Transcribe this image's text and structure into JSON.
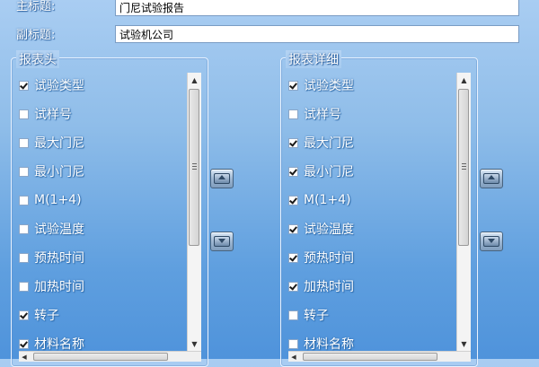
{
  "header": {
    "main_title_label": "主标题:",
    "main_title_value": "门尼试验报告",
    "sub_title_label": "副标题:",
    "sub_title_value": "试验机公司"
  },
  "left_group": {
    "title": "报表头",
    "items": [
      {
        "label": "试验类型",
        "checked": true
      },
      {
        "label": "试样号",
        "checked": false
      },
      {
        "label": "最大门尼",
        "checked": false
      },
      {
        "label": "最小门尼",
        "checked": false
      },
      {
        "label": "M(1+4)",
        "checked": false
      },
      {
        "label": "试验温度",
        "checked": false
      },
      {
        "label": "预热时间",
        "checked": false
      },
      {
        "label": "加热时间",
        "checked": false
      },
      {
        "label": "转子",
        "checked": true
      },
      {
        "label": "材料名称",
        "checked": true
      }
    ],
    "move_up_icon": "move-up-icon",
    "move_down_icon": "move-down-icon"
  },
  "right_group": {
    "title": "报表详细",
    "items": [
      {
        "label": "试验类型",
        "checked": true
      },
      {
        "label": "试样号",
        "checked": false
      },
      {
        "label": "最大门尼",
        "checked": true
      },
      {
        "label": "最小门尼",
        "checked": true
      },
      {
        "label": "M(1+4)",
        "checked": true
      },
      {
        "label": "试验温度",
        "checked": true
      },
      {
        "label": "预热时间",
        "checked": true
      },
      {
        "label": "加热时间",
        "checked": true
      },
      {
        "label": "转子",
        "checked": false
      },
      {
        "label": "材料名称",
        "checked": false
      }
    ],
    "move_up_icon": "move-up-icon",
    "move_down_icon": "move-down-icon"
  },
  "scrollbar": {
    "up_glyph": "▲",
    "down_glyph": "▼",
    "left_glyph": "◀",
    "right_glyph": "▶"
  }
}
